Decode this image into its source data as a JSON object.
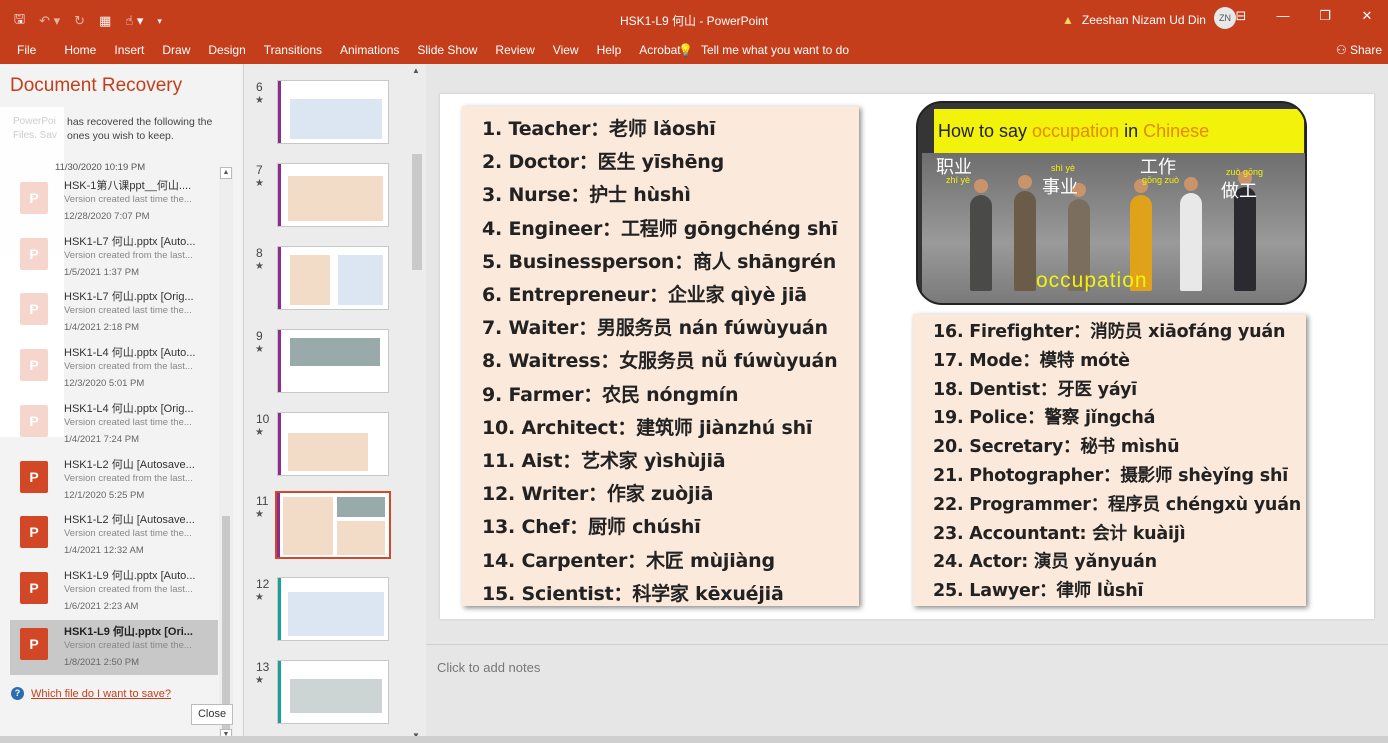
{
  "titlebar": {
    "doc_title": "HSK1-L9 何山  -  PowerPoint",
    "user_name": "Zeeshan Nizam Ud Din",
    "user_initials": "ZN"
  },
  "ribbon": {
    "tabs": [
      "File",
      "Home",
      "Insert",
      "Draw",
      "Design",
      "Transitions",
      "Animations",
      "Slide Show",
      "Review",
      "View",
      "Help",
      "Acrobat"
    ],
    "tell_me": "Tell me what you want to do",
    "share": "Share"
  },
  "recovery": {
    "title": "Document Recovery",
    "desc_left": "PowerPoi Files. Sav",
    "description": "has recovered the following the ones you wish to keep.",
    "first_date": "11/30/2020 10:19 PM",
    "items": [
      {
        "name": "HSK-1第八课ppt__何山....",
        "sub": "Version created last time the...",
        "date": "12/28/2020 7:07 PM"
      },
      {
        "name": "HSK1-L7 何山.pptx  [Auto...",
        "sub": "Version created from the last...",
        "date": "1/5/2021 1:37 PM"
      },
      {
        "name": "HSK1-L7 何山.pptx  [Orig...",
        "sub": "Version created last time the...",
        "date": "1/4/2021 2:18 PM"
      },
      {
        "name": "HSK1-L4 何山.pptx  [Auto...",
        "sub": "Version created from the last...",
        "date": "12/3/2020 5:01 PM"
      },
      {
        "name": "HSK1-L4 何山.pptx  [Orig...",
        "sub": "Version created last time the...",
        "date": "1/4/2021 7:24 PM"
      },
      {
        "name": "HSK1-L2 何山  [Autosave...",
        "sub": "Version created from the last...",
        "date": "12/1/2020 5:25 PM"
      },
      {
        "name": "HSK1-L2 何山  [Autosave...",
        "sub": "Version created last time the...",
        "date": "1/4/2021 12:32 AM"
      },
      {
        "name": "HSK1-L9 何山.pptx  [Auto...",
        "sub": "Version created from the last...",
        "date": "1/6/2021 2:23 AM"
      },
      {
        "name": "HSK1-L9 何山.pptx  [Ori...",
        "sub": "Version created last time the...",
        "date": "1/8/2021 2:50 PM"
      }
    ],
    "help_link": "Which file do I want to save?",
    "close_label": "Close"
  },
  "thumbnails": [
    {
      "num": "6"
    },
    {
      "num": "7"
    },
    {
      "num": "8"
    },
    {
      "num": "9"
    },
    {
      "num": "10"
    },
    {
      "num": "11"
    },
    {
      "num": "12"
    },
    {
      "num": "13"
    }
  ],
  "slide": {
    "left_list": [
      "1. Teacher：老师 lǎoshī",
      "2. Doctor：医生 yīshēng",
      "3. Nurse：护士 hùshì",
      "4. Engineer：工程师 gōngchéng shī",
      "5. Businessperson：商人 shāngrén",
      "6. Entrepreneur：企业家  qìyè jiā",
      "7. Waiter：男服务员 nán fúwùyuán",
      "8. Waitress：女服务员 nǚ fúwùyuán",
      "9. Farmer：农民 nóngmín",
      "10. Architect：建筑师 jiànzhú shī",
      "11. Aist：艺术家 yìshùjiā",
      "12. Writer：作家 zuòjiā",
      "13. Chef：厨师 chúshī",
      "14. Carpenter：木匠 mùjiàng",
      "15. Scientist：科学家 kēxuéjiā"
    ],
    "right_list": [
      "16. Firefighter：消防员 xiāofáng yuán",
      "17. Mode：模特 mótè",
      "18. Dentist：牙医 yáyī",
      "19. Police：警察 jǐngchá",
      "20. Secretary：秘书 mìshū",
      "21. Photographer：摄影师  shèyǐng shī",
      "22. Programmer：程序员 chéngxù yuán",
      "23. Accountant: 会计 kuàijì",
      "24. Actor: 演员 yǎnyuán",
      "25. Lawyer：律师 lǜshī"
    ],
    "occupation_box": {
      "title_pre": "How to say ",
      "title_accent1": "occupation",
      "title_mid": " in ",
      "title_accent2": "Chinese",
      "cn1": "职业",
      "py1": "zhí  yè",
      "cn2": "事业",
      "py2": "shì  yè",
      "cn3": "工作",
      "py3": "gōng zuò",
      "cn4": "做工",
      "py4": "zuò gōng",
      "word": "occupation"
    }
  },
  "notes_placeholder": "Click to add notes",
  "colors": {
    "accent": "#c43e1c",
    "card": "#fbe9dc",
    "highlight": "#f2f20a"
  }
}
